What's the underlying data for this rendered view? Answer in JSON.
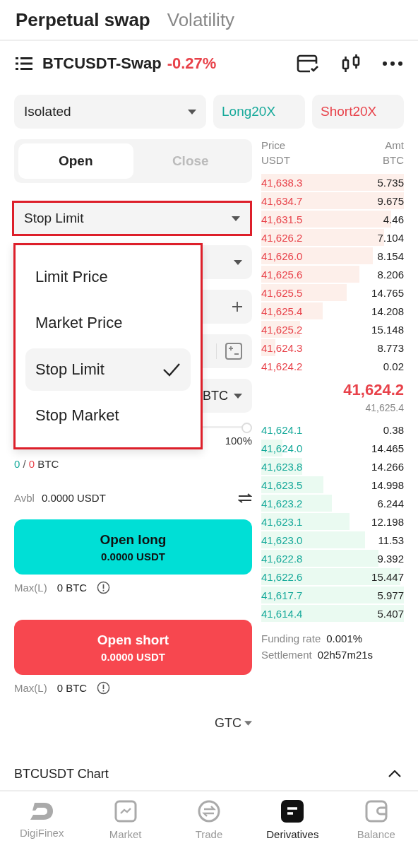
{
  "header_tabs": [
    {
      "label": "Perpetual swap",
      "selected": true
    },
    {
      "label": "Volatility",
      "selected": false
    }
  ],
  "symbol": {
    "name": "BTCUSDT-Swap",
    "change": "-0.27%"
  },
  "margin_mode": "Isolated",
  "leverage": {
    "long": "Long20X",
    "short": "Short20X"
  },
  "side_tabs": [
    {
      "label": "Open",
      "selected": true
    },
    {
      "label": "Close",
      "selected": false
    }
  ],
  "order_type": {
    "value": "Stop Limit",
    "expanded": true
  },
  "order_type_menu": [
    {
      "label": "Limit Price",
      "selected": false
    },
    {
      "label": "Market Price",
      "selected": false
    },
    {
      "label": "Stop Limit",
      "selected": true
    },
    {
      "label": "Stop Market",
      "selected": false
    }
  ],
  "quantity_unit": "BTC",
  "slider_label": "100%",
  "position": {
    "long": "0",
    "separator": "/",
    "short": "0",
    "unit": "BTC"
  },
  "available": {
    "label": "Avbl",
    "value": "0.0000 USDT"
  },
  "actions": [
    {
      "kind": "long",
      "label": "Open long",
      "amount": "0.0000 USDT",
      "max_label": "Max(L)",
      "max_value": "0 BTC"
    },
    {
      "kind": "short",
      "label": "Open short",
      "amount": "0.0000 USDT",
      "max_label": "Max(L)",
      "max_value": "0 BTC"
    }
  ],
  "time_in_force": "GTC",
  "order_book": {
    "price_header": [
      "Price",
      "USDT"
    ],
    "amount_header": [
      "Amt",
      "BTC"
    ],
    "asks": [
      {
        "price": "41,638.3",
        "amount": "5.735"
      },
      {
        "price": "41,634.7",
        "amount": "9.675"
      },
      {
        "price": "41,631.5",
        "amount": "4.46"
      },
      {
        "price": "41,626.2",
        "amount": "7.104"
      },
      {
        "price": "41,626.0",
        "amount": "8.154"
      },
      {
        "price": "41,625.6",
        "amount": "8.206"
      },
      {
        "price": "41,625.5",
        "amount": "14.765"
      },
      {
        "price": "41,625.4",
        "amount": "14.208"
      },
      {
        "price": "41,625.2",
        "amount": "15.148"
      },
      {
        "price": "41,624.3",
        "amount": "8.773"
      },
      {
        "price": "41,624.2",
        "amount": "0.02"
      }
    ],
    "last_price": "41,624.2",
    "mark_price": "41,625.4",
    "bids": [
      {
        "price": "41,624.1",
        "amount": "0.38"
      },
      {
        "price": "41,624.0",
        "amount": "14.465"
      },
      {
        "price": "41,623.8",
        "amount": "14.266"
      },
      {
        "price": "41,623.5",
        "amount": "14.998"
      },
      {
        "price": "41,623.2",
        "amount": "6.244"
      },
      {
        "price": "41,623.1",
        "amount": "12.198"
      },
      {
        "price": "41,623.0",
        "amount": "11.53"
      },
      {
        "price": "41,622.8",
        "amount": "9.392"
      },
      {
        "price": "41,622.6",
        "amount": "15.447"
      },
      {
        "price": "41,617.7",
        "amount": "5.977"
      },
      {
        "price": "41,614.4",
        "amount": "5.407"
      }
    ],
    "funding": {
      "label": "Funding rate",
      "value": "0.001%"
    },
    "settlement": {
      "label": "Settlement",
      "value": "02h57m21s"
    }
  },
  "chart_bar": {
    "label": "BTCUSDT Chart",
    "expanded": true
  },
  "nav": [
    {
      "label": "DigiFinex",
      "selected": false
    },
    {
      "label": "Market",
      "selected": false
    },
    {
      "label": "Trade",
      "selected": false
    },
    {
      "label": "Derivatives",
      "selected": true
    },
    {
      "label": "Balance",
      "selected": false
    }
  ]
}
